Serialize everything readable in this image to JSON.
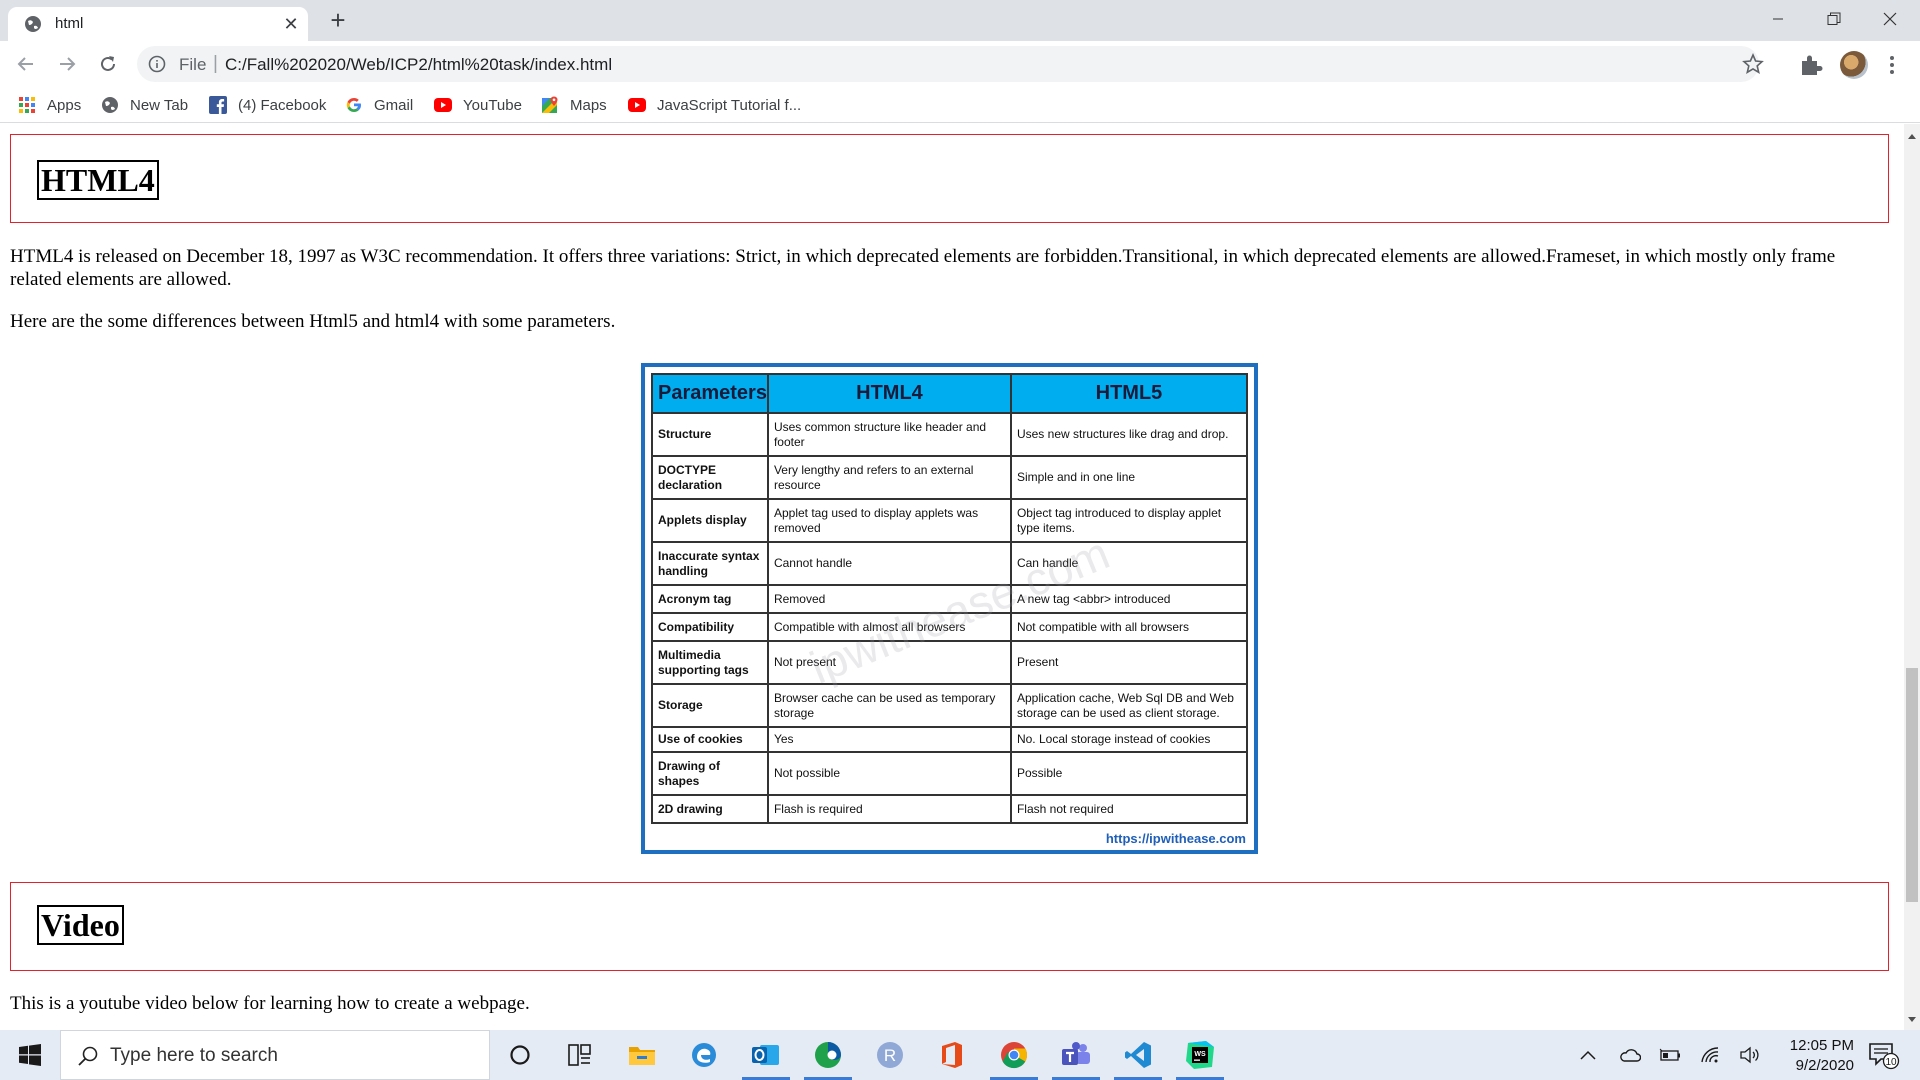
{
  "browser": {
    "tab_title": "html",
    "address": {
      "scheme_label": "File",
      "url": "C:/Fall%202020/Web/ICP2/html%20task/index.html"
    },
    "bookmarks": [
      {
        "label": "Apps",
        "icon": "apps-grid-icon"
      },
      {
        "label": "New Tab",
        "icon": "globe-icon"
      },
      {
        "label": "(4) Facebook",
        "icon": "facebook-icon"
      },
      {
        "label": "Gmail",
        "icon": "google-icon"
      },
      {
        "label": "YouTube",
        "icon": "youtube-icon"
      },
      {
        "label": "Maps",
        "icon": "maps-icon"
      },
      {
        "label": "JavaScript Tutorial f...",
        "icon": "youtube-icon"
      }
    ]
  },
  "page": {
    "html4_heading": "HTML4",
    "html4_paragraph": "HTML4 is released on December 18, 1997 as W3C recommendation. It offers three variations: Strict, in which deprecated elements are forbidden.Transitional, in which deprecated elements are allowed.Frameset, in which mostly only frame related elements are allowed.",
    "differences_intro": "Here are the some differences between Html5 and html4 with some parameters.",
    "comparison": {
      "headers": [
        "Parameters",
        "HTML4",
        "HTML5"
      ],
      "rows": [
        {
          "param": "Structure",
          "html4": "Uses common structure like header and footer",
          "html5": "Uses new structures like drag and drop."
        },
        {
          "param": "DOCTYPE declaration",
          "html4": "Very lengthy and refers to an external resource",
          "html5": "Simple and in one line"
        },
        {
          "param": "Applets display",
          "html4": "Applet tag used to display applets was removed",
          "html5": "Object tag introduced to display applet type items."
        },
        {
          "param": "Inaccurate syntax handling",
          "html4": "Cannot handle",
          "html5": "Can handle"
        },
        {
          "param": "Acronym tag",
          "html4": "Removed",
          "html5": "A new tag <abbr> introduced"
        },
        {
          "param": "Compatibility",
          "html4": "Compatible with almost all browsers",
          "html5": "Not compatible with all browsers"
        },
        {
          "param": "Multimedia supporting tags",
          "html4": "Not present",
          "html5": "Present"
        },
        {
          "param": "Storage",
          "html4": "Browser cache can be used as temporary storage",
          "html5": "Application cache, Web Sql DB and Web storage can be used as client storage."
        },
        {
          "param": "Use of cookies",
          "html4": "Yes",
          "html5": "No. Local storage instead of cookies"
        },
        {
          "param": "Drawing of shapes",
          "html4": "Not possible",
          "html5": "Possible"
        },
        {
          "param": "2D drawing",
          "html4": "Flash is required",
          "html5": "Flash not required"
        }
      ],
      "watermark": "ipwithease.com",
      "source": "https://ipwithease.com"
    },
    "video_heading": "Video",
    "video_paragraph": "This is a youtube video below for learning how to create a webpage."
  },
  "taskbar": {
    "search_placeholder": "Type here to search",
    "apps": [
      "task-view-icon",
      "file-explorer-icon",
      "edge-legacy-icon",
      "outlook-icon",
      "edge-icon",
      "r-icon",
      "office-icon",
      "chrome-icon",
      "teams-icon",
      "vscode-icon",
      "webstorm-icon"
    ],
    "clock_time": "12:05 PM",
    "clock_date": "9/2/2020",
    "notification_count": "10"
  },
  "colors": {
    "section_border": "#e3232b",
    "table_header": "#00aeef",
    "image_frame": "#1f6fc0"
  }
}
